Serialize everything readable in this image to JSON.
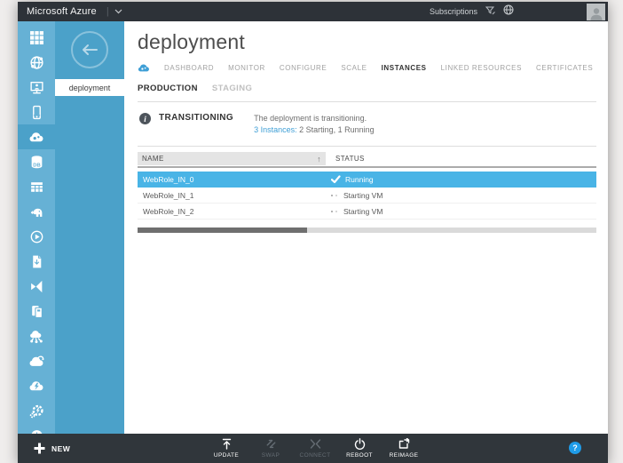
{
  "topbar": {
    "brand": "Microsoft Azure",
    "subscriptions_label": "Subscriptions"
  },
  "sidebar": {
    "flyout_item": "deployment",
    "icons": [
      "all-items-grid-icon",
      "web-sites-globe-icon",
      "virtual-machines-monitor-icon",
      "mobile-services-phone-icon",
      "cloud-services-icon",
      "sql-databases-icon",
      "storage-table-icon",
      "hdinsight-elephant-icon",
      "media-services-icon",
      "service-bus-icon",
      "visual-studio-online-icon",
      "cache-icon",
      "biztalk-services-icon",
      "backup-vaults-icon",
      "recovery-services-icon",
      "automation-icon",
      "scheduler-clock-icon"
    ],
    "active_icon": "cloud-services-icon"
  },
  "page": {
    "title": "deployment",
    "tabs": [
      "DASHBOARD",
      "MONITOR",
      "CONFIGURE",
      "SCALE",
      "INSTANCES",
      "LINKED RESOURCES",
      "CERTIFICATES"
    ],
    "active_tab": "INSTANCES",
    "slots": [
      "PRODUCTION",
      "STAGING"
    ],
    "active_slot": "PRODUCTION",
    "notice": {
      "heading": "TRANSITIONING",
      "line1": "The deployment is transitioning.",
      "link_text": "3 Instances:",
      "line2_rest": " 2 Starting, 1 Running"
    },
    "table": {
      "columns": [
        "NAME",
        "STATUS"
      ],
      "sort_indicator": "↑",
      "rows": [
        {
          "name": "WebRole_IN_0",
          "status": "Running",
          "selected": true
        },
        {
          "name": "WebRole_IN_1",
          "status": "Starting VM",
          "selected": false
        },
        {
          "name": "WebRole_IN_2",
          "status": "Starting VM",
          "selected": false
        }
      ]
    }
  },
  "bottombar": {
    "new_label": "NEW",
    "commands": [
      {
        "label": "UPDATE",
        "enabled": true
      },
      {
        "label": "SWAP",
        "enabled": false
      },
      {
        "label": "CONNECT",
        "enabled": false
      },
      {
        "label": "REBOOT",
        "enabled": true
      },
      {
        "label": "REIMAGE",
        "enabled": true
      }
    ],
    "help_label": "?"
  },
  "colors": {
    "topbar_bg": "#2d3238",
    "sidebar_strip": "#66b1d5",
    "sidebar_flyout": "#4ba1c9",
    "selected_row": "#49b4e6",
    "link_blue": "#3f9fd6",
    "bottombar_bg": "#30363b",
    "help_blue": "#1f9ce8"
  }
}
